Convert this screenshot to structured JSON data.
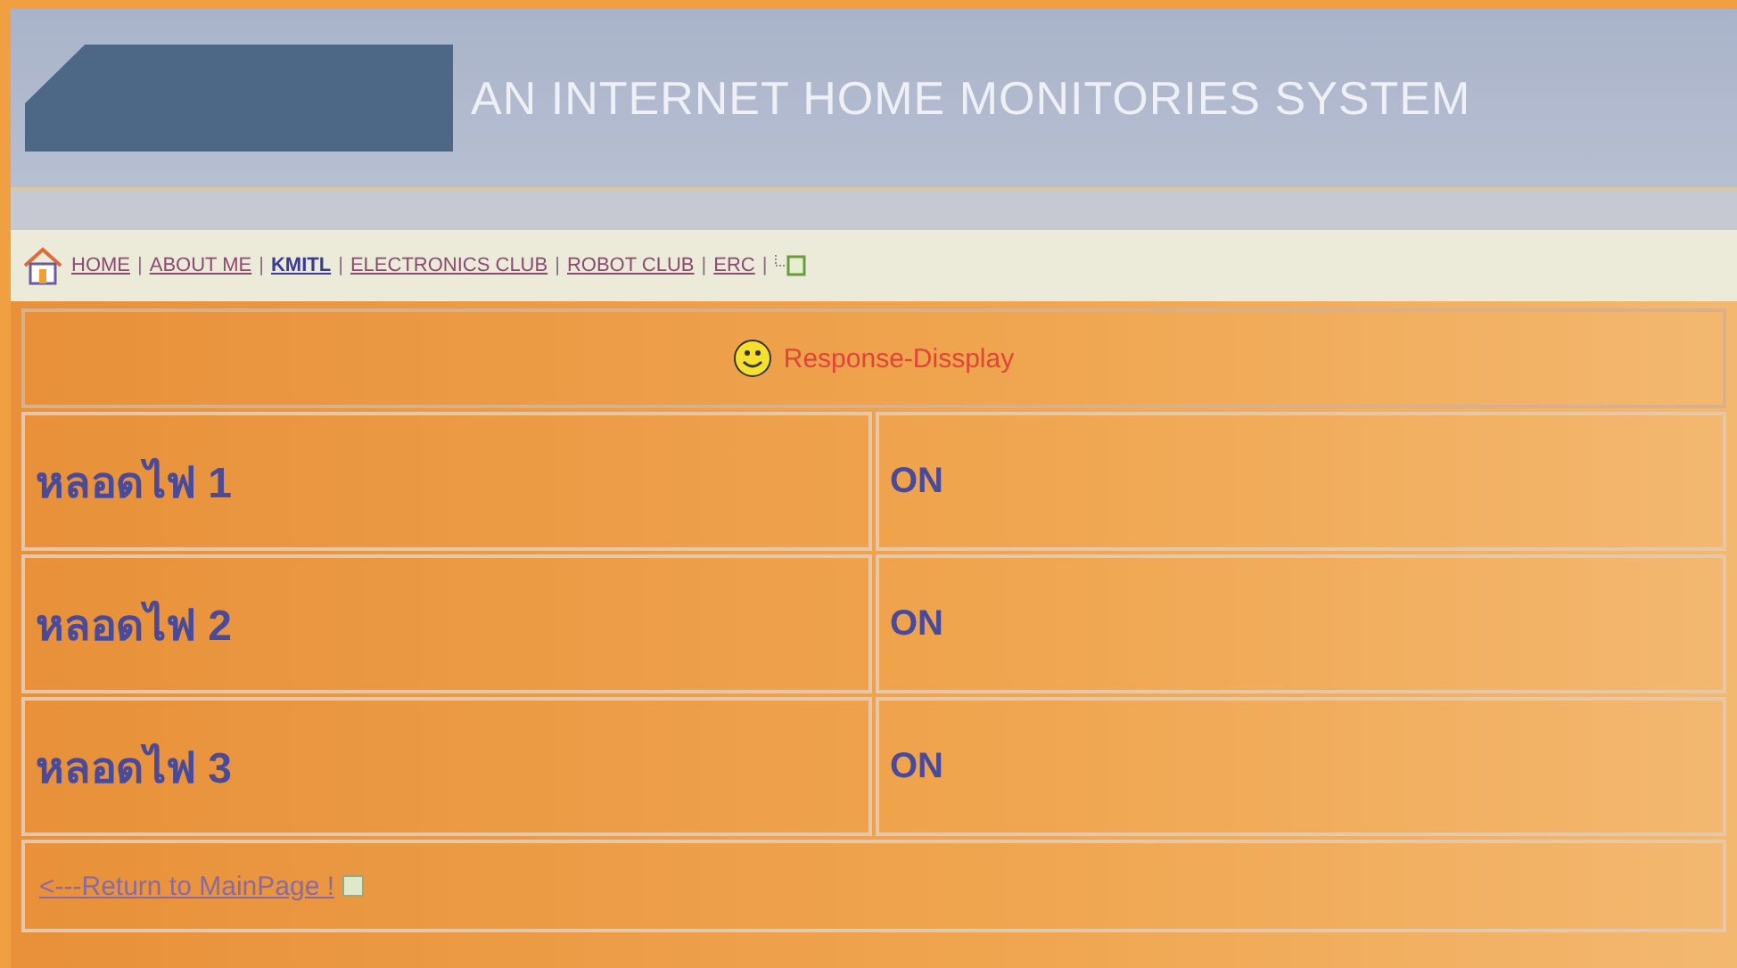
{
  "header": {
    "title": "AN INTERNET HOME MONITORIES SYSTEM"
  },
  "nav": {
    "separator": "|",
    "links": [
      {
        "label": "HOME",
        "selected": false
      },
      {
        "label": "ABOUT ME",
        "selected": false
      },
      {
        "label": "KMITL",
        "selected": true
      },
      {
        "label": "ELECTRONICS CLUB",
        "selected": false
      },
      {
        "label": "ROBOT CLUB",
        "selected": false
      },
      {
        "label": "ERC",
        "selected": false
      }
    ]
  },
  "panel": {
    "heading": "Response-Dissplay",
    "rows": [
      {
        "device": "หลอดไฟ 1",
        "status": "ON"
      },
      {
        "device": "หลอดไฟ 2",
        "status": "ON"
      },
      {
        "device": "หลอดไฟ 3",
        "status": "ON"
      }
    ],
    "return_link": "<---Return to MainPage !"
  }
}
